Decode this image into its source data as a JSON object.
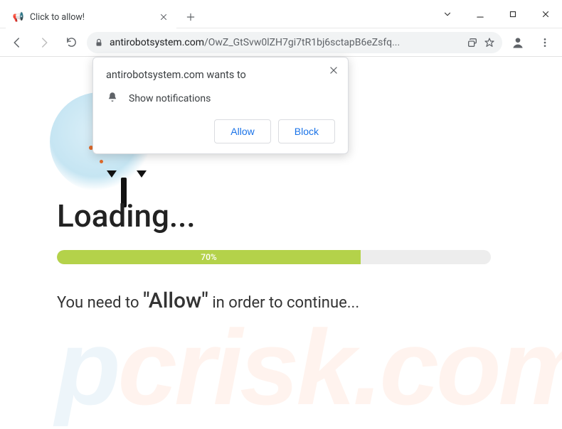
{
  "window": {
    "tab": {
      "title": "Click to allow!",
      "favicon_emoji": "📢"
    }
  },
  "toolbar": {
    "url_host": "antirobotsystem.com",
    "url_path": "/OwZ_GtSvw0lZH7gi7tR1bj6sctapB6eZsfq..."
  },
  "permission": {
    "title": "antirobotsystem.com wants to",
    "item": "Show notifications",
    "allow": "Allow",
    "block": "Block"
  },
  "page": {
    "loading_title": "Loading...",
    "progress_percent": "70%",
    "cta_prefix": "You need to ",
    "cta_quote": "\"Allow\"",
    "cta_suffix": " in order to continue..."
  },
  "watermark": {
    "p": "p",
    "rest": "crisk.com"
  }
}
